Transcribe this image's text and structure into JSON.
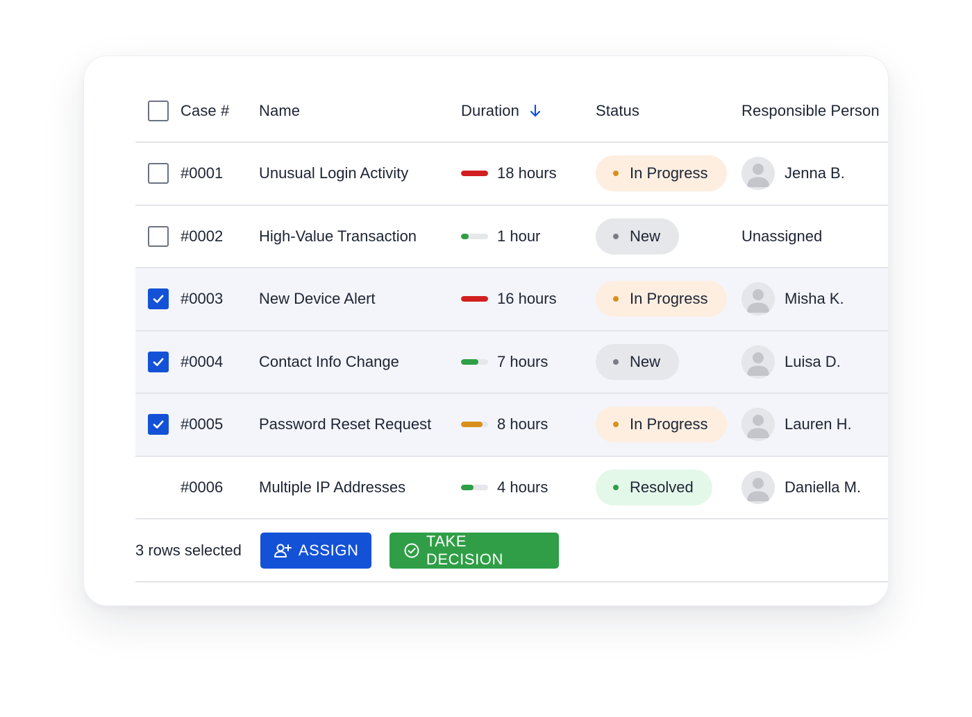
{
  "table": {
    "headers": {
      "case": "Case #",
      "name": "Name",
      "duration": "Duration",
      "status": "Status",
      "person": "Responsible Person"
    },
    "rows": [
      {
        "case": "#0001",
        "name": "Unusual Login Activity",
        "duration": "18 hours",
        "duration_level": 1.0,
        "duration_color": "#d21f1f",
        "status": "In Progress",
        "status_bg": "#fdeee0",
        "status_dot": "#d9901c",
        "person": "Jenna B.",
        "has_avatar": true,
        "checked": false,
        "has_checkbox": true
      },
      {
        "case": "#0002",
        "name": "High-Value Transaction",
        "duration": "1 hour",
        "duration_level": 0.28,
        "duration_color": "#2f9e46",
        "status": "New",
        "status_bg": "#e6e7ea",
        "status_dot": "#7a7d85",
        "person": "Unassigned",
        "has_avatar": false,
        "checked": false,
        "has_checkbox": true
      },
      {
        "case": "#0003",
        "name": "New Device Alert",
        "duration": "16 hours",
        "duration_level": 1.0,
        "duration_color": "#d21f1f",
        "status": "In Progress",
        "status_bg": "#fdeee0",
        "status_dot": "#d9901c",
        "person": "Misha K.",
        "has_avatar": true,
        "checked": true,
        "has_checkbox": true
      },
      {
        "case": "#0004",
        "name": "Contact Info Change",
        "duration": "7 hours",
        "duration_level": 0.65,
        "duration_color": "#2f9e46",
        "status": "New",
        "status_bg": "#e6e7ea",
        "status_dot": "#7a7d85",
        "person": "Luisa D.",
        "has_avatar": true,
        "checked": true,
        "has_checkbox": true
      },
      {
        "case": "#0005",
        "name": "Password Reset Request",
        "duration": "8 hours",
        "duration_level": 0.8,
        "duration_color": "#d9901c",
        "status": "In Progress",
        "status_bg": "#fdeee0",
        "status_dot": "#d9901c",
        "person": "Lauren H.",
        "has_avatar": true,
        "checked": true,
        "has_checkbox": true
      },
      {
        "case": "#0006",
        "name": "Multiple IP Addresses",
        "duration": "4 hours",
        "duration_level": 0.45,
        "duration_color": "#2f9e46",
        "status": "Resolved",
        "status_bg": "#e4f8ea",
        "status_dot": "#2f9e46",
        "person": "Daniella M.",
        "has_avatar": true,
        "checked": false,
        "has_checkbox": false
      }
    ]
  },
  "footer": {
    "selection_text": "3 rows selected",
    "assign_label": "ASSIGN",
    "decision_label": "TAKE DECISION"
  },
  "colors": {
    "primary": "#1352d6",
    "success": "#2f9e46",
    "danger": "#d21f1f",
    "warning": "#d9901c"
  }
}
